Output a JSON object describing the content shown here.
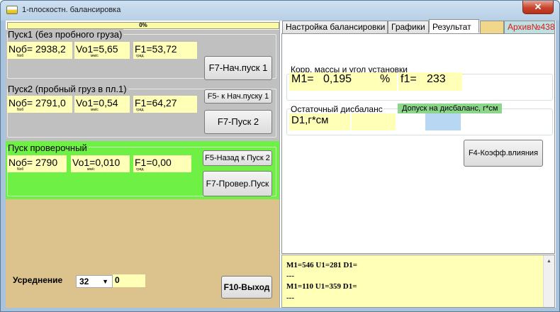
{
  "window": {
    "title": "1-плоскостн. балансировка",
    "close_glyph": "✕"
  },
  "progress": {
    "label": "0%",
    "value": 0
  },
  "run1": {
    "title": "Пуск1 (без пробного груза)",
    "nob": "Nоб= 2938,2",
    "nob_unit": "Nоб",
    "vo": "Vo1=5,65",
    "vo_unit": "мм/с",
    "f": "F1=53,72",
    "f_unit": "град.",
    "btn_start": "F7-Нач.пуск 1"
  },
  "run2": {
    "title": "Пуск2 (пробный груз в пл.1)",
    "nob": "Nоб= 2791,0",
    "nob_unit": "Nоб",
    "vo": "Vo1=0,54",
    "vo_unit": "мм/с",
    "f": "F1=64,27",
    "f_unit": "град.",
    "btn_back": "F5- к Нач.пуску 1",
    "btn_run": "F7-Пуск 2"
  },
  "check": {
    "title": "Пуск проверочный",
    "nob": "Nоб= 2790",
    "nob_unit": "Nоб",
    "vo": "Vo1=0,010",
    "vo_unit": "мм/с",
    "f": "F1=0,00",
    "f_unit": "град.",
    "btn_back": "F5-Назад к Пуск 2",
    "btn_run": "F7-Провер.Пуск"
  },
  "averaging": {
    "label": "Усреднение",
    "selected": "32",
    "value": "0"
  },
  "exit_button": "F10-Выход",
  "tabs": [
    {
      "label": "Настройка балансировки"
    },
    {
      "label": "Графики"
    },
    {
      "label": "Результат"
    },
    {
      "label": ""
    },
    {
      "label": "Архив№438"
    }
  ],
  "result": {
    "correction_title": "Корр. массы и угол установки",
    "m1_label": "M1=",
    "m1_value": "0,195",
    "m1_unit": "%",
    "f1_label": "f1=",
    "f1_value": "233",
    "residual_title": "Остаточный дисбаланс",
    "tolerance_label": "Допуск на дисбаланс, г*см",
    "d1_label": "D1,г*см",
    "coef_button": "F4-Коэфф.влияния"
  },
  "log": {
    "lines": [
      "M1=546 U1=281 D1=",
      "---",
      "M1=110 U1=359 D1=",
      "---"
    ]
  },
  "colors": {
    "yellow_field": "#ffffb8",
    "grey_panel": "#c0c0c0",
    "green_panel": "#6ef044",
    "tan_panel": "#dcc28c",
    "archive_text": "#d81818",
    "tolerance_bg": "#8bd68b"
  },
  "icons": {
    "app": "app-window-icon",
    "close": "close-icon",
    "dropdown": "chevron-down-icon",
    "scroll": "scroll-up-arrow-icon"
  }
}
